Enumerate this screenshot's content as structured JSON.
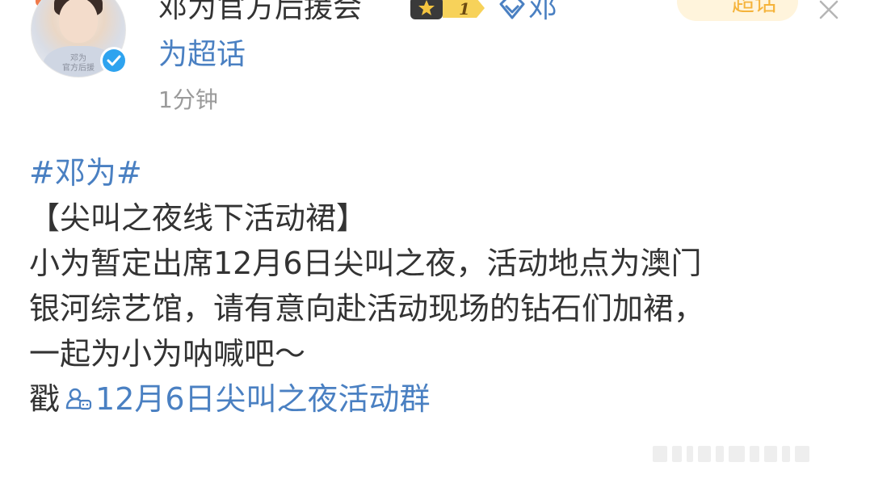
{
  "header": {
    "username": "邓为官方后援会",
    "level_badge_text": "1",
    "topic_link_part1": "邓",
    "topic_link_part2": "为超话",
    "timestamp": "1分钟",
    "supertopic_button": "超话",
    "avatar_caption": "邓为\n官方后援",
    "colors": {
      "link": "#4a80c2",
      "verified": "#2ea3ef",
      "badge_gold": "#f5c540",
      "supertopic": "#f5b33b"
    }
  },
  "post": {
    "hashtag": "#邓为#",
    "title": "【尖叫之夜线下活动裙】",
    "body_lines": [
      "小为暂定出席12月6日尖叫之夜，活动地点为澳门",
      "银河综艺馆，请有意向赴活动现场的钻石们加裙，",
      "一起为小为呐喊吧～"
    ],
    "poke_label": "戳",
    "group_link": "12月6日尖叫之夜活动群"
  },
  "icons": {
    "verified": "verified-check-icon",
    "level": "fan-level-badge-icon",
    "topic": "diamond-icon",
    "close": "close-icon",
    "group": "group-chat-icon"
  }
}
